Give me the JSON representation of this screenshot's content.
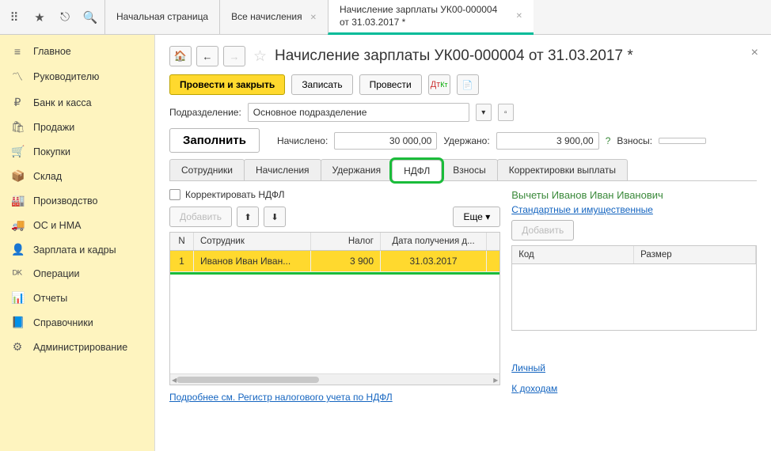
{
  "topbar": {
    "tabs": [
      {
        "label": "Начальная страница",
        "closable": false
      },
      {
        "label": "Все начисления",
        "closable": true
      },
      {
        "label": "Начисление зарплаты УК00-000004 от 31.03.2017 *",
        "closable": true,
        "active": true
      }
    ]
  },
  "sidebar": {
    "items": [
      {
        "icon": "≡",
        "label": "Главное"
      },
      {
        "icon": "〽",
        "label": "Руководителю"
      },
      {
        "icon": "₽",
        "label": "Банк и касса"
      },
      {
        "icon": "🛍",
        "label": "Продажи"
      },
      {
        "icon": "🛒",
        "label": "Покупки"
      },
      {
        "icon": "📦",
        "label": "Склад"
      },
      {
        "icon": "🏭",
        "label": "Производство"
      },
      {
        "icon": "🚚",
        "label": "ОС и НМА"
      },
      {
        "icon": "👤",
        "label": "Зарплата и кадры"
      },
      {
        "icon": "ᴰᴷ",
        "label": "Операции"
      },
      {
        "icon": "📊",
        "label": "Отчеты"
      },
      {
        "icon": "📘",
        "label": "Справочники"
      },
      {
        "icon": "⚙",
        "label": "Администрирование"
      }
    ]
  },
  "page": {
    "title": "Начисление зарплаты УК00-000004 от 31.03.2017 *",
    "toolbar": {
      "post_close": "Провести и закрыть",
      "save": "Записать",
      "post": "Провести"
    },
    "department_lbl": "Подразделение:",
    "department_val": "Основное подразделение",
    "fill_btn": "Заполнить",
    "accrued_lbl": "Начислено:",
    "accrued_val": "30 000,00",
    "withheld_lbl": "Удержано:",
    "withheld_val": "3 900,00",
    "contrib_lbl": "Взносы:",
    "tabs": [
      "Сотрудники",
      "Начисления",
      "Удержания",
      "НДФЛ",
      "Взносы",
      "Корректировки выплаты"
    ],
    "active_tab": "НДФЛ",
    "adjust_label": "Корректировать НДФЛ",
    "add_btn": "Добавить",
    "more_btn": "Еще",
    "columns": {
      "n": "N",
      "emp": "Сотрудник",
      "tax": "Налог",
      "date": "Дата получения д..."
    },
    "rows": [
      {
        "n": "1",
        "emp": "Иванов Иван Иван...",
        "tax": "3 900",
        "date": "31.03.2017"
      }
    ],
    "footer_link": "Подробнее см. Регистр налогового учета по НДФЛ",
    "right": {
      "title": "Вычеты Иванов Иван Иванович",
      "link1": "Стандартные и имущественные",
      "add": "Добавить",
      "col1": "Код",
      "col2": "Размер",
      "personal": "Личный",
      "income": "К доходам"
    }
  }
}
